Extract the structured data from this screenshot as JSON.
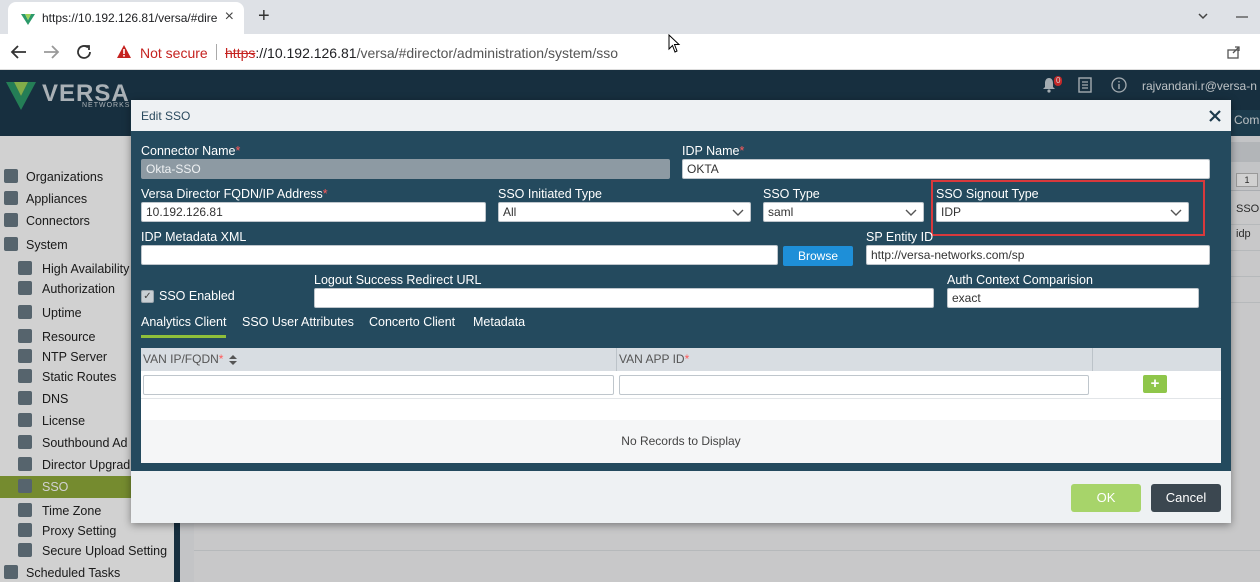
{
  "browser": {
    "tab_title": "https://10.192.126.81/versa/#dire",
    "new_tab_glyph": "+",
    "security_label": "Not secure",
    "url_scheme": "https",
    "url_rest_host": "://10.192.126.81",
    "url_path": "/versa/#director/administration/system/sso"
  },
  "header": {
    "logo_text": "VERSA",
    "logo_sub": "NETWORKS",
    "notification_count": "0",
    "user": "rajvandani.r@versa-n",
    "partial_tab": "Com"
  },
  "sidebar": {
    "items": [
      {
        "label": "Organizations"
      },
      {
        "label": "Appliances"
      },
      {
        "label": "Connectors"
      },
      {
        "label": "System"
      },
      {
        "label": "High Availability"
      },
      {
        "label": "Authorization"
      },
      {
        "label": "Uptime"
      },
      {
        "label": "Resource"
      },
      {
        "label": "NTP Server"
      },
      {
        "label": "Static Routes"
      },
      {
        "label": "DNS"
      },
      {
        "label": "License"
      },
      {
        "label": "Southbound Ad"
      },
      {
        "label": "Director Upgrad"
      },
      {
        "label": "SSO"
      },
      {
        "label": "Time Zone"
      },
      {
        "label": "Proxy Setting"
      },
      {
        "label": "Secure Upload Setting"
      },
      {
        "label": "Scheduled Tasks"
      }
    ]
  },
  "background_grid": {
    "pager": "1",
    "col_sso": "SSO",
    "row_idp": "idp"
  },
  "modal": {
    "title": "Edit SSO",
    "fields": {
      "connector_name": {
        "label": "Connector Name",
        "value": "Okta-SSO"
      },
      "idp_name": {
        "label": "IDP Name",
        "value": "OKTA"
      },
      "director_fqdn": {
        "label": "Versa Director FQDN/IP Address",
        "value": "10.192.126.81"
      },
      "sso_initiated_type": {
        "label": "SSO Initiated Type",
        "value": "All"
      },
      "sso_type": {
        "label": "SSO Type",
        "value": "saml"
      },
      "sso_signout_type": {
        "label": "SSO Signout Type",
        "value": "IDP"
      },
      "idp_metadata_xml": {
        "label": "IDP Metadata XML",
        "value": ""
      },
      "sp_entity_id": {
        "label": "SP Entity ID",
        "value": "http://versa-networks.com/sp"
      },
      "sso_enabled": {
        "label": "SSO Enabled"
      },
      "logout_redirect": {
        "label": "Logout Success Redirect URL",
        "value": ""
      },
      "auth_context": {
        "label": "Auth Context Comparision",
        "value": "exact"
      }
    },
    "required_marker": "*",
    "browse_label": "Browse",
    "tabs": [
      "Analytics Client",
      "SSO User Attributes",
      "Concerto Client",
      "Metadata"
    ],
    "grid": {
      "col1": "VAN IP/FQDN",
      "col2": "VAN APP ID",
      "add_glyph": "+",
      "empty_text": "No Records to Display"
    },
    "ok_label": "OK",
    "cancel_label": "Cancel"
  }
}
